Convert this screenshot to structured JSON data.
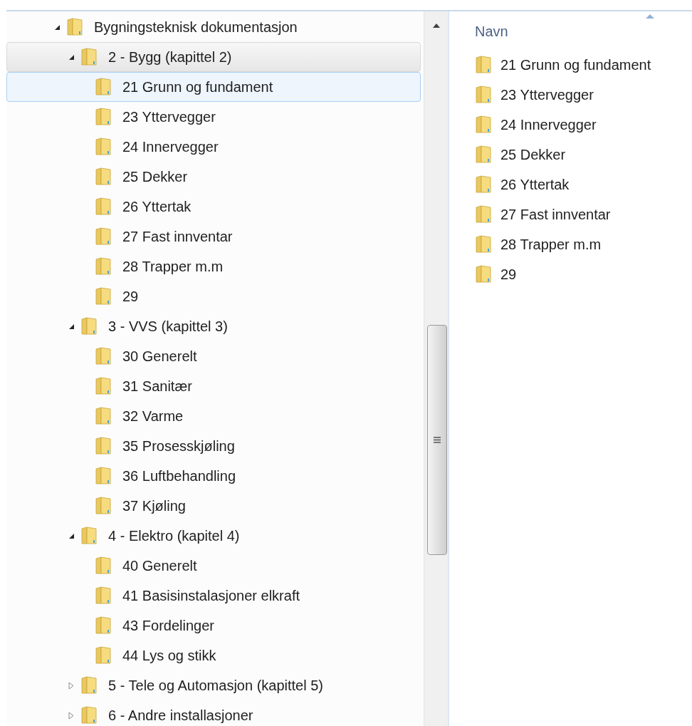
{
  "tree": [
    {
      "label": "Bygningsteknisk dokumentasjon",
      "expanded": true,
      "selected": false,
      "hovered": false,
      "children": [
        {
          "label": "2 - Bygg (kapittel 2)",
          "expanded": true,
          "selected": false,
          "hovered": true,
          "children": [
            {
              "label": "21 Grunn og fundament",
              "selected": true,
              "hovered": false
            },
            {
              "label": "23 Yttervegger",
              "selected": false,
              "hovered": false
            },
            {
              "label": "24 Innervegger",
              "selected": false,
              "hovered": false
            },
            {
              "label": "25 Dekker",
              "selected": false,
              "hovered": false
            },
            {
              "label": "26 Yttertak",
              "selected": false,
              "hovered": false
            },
            {
              "label": "27 Fast innventar",
              "selected": false,
              "hovered": false
            },
            {
              "label": "28 Trapper m.m",
              "selected": false,
              "hovered": false
            },
            {
              "label": "29",
              "selected": false,
              "hovered": false
            }
          ]
        },
        {
          "label": "3 - VVS (kapittel 3)",
          "expanded": true,
          "selected": false,
          "hovered": false,
          "children": [
            {
              "label": "30 Generelt",
              "selected": false,
              "hovered": false
            },
            {
              "label": "31 Sanitær",
              "selected": false,
              "hovered": false
            },
            {
              "label": "32 Varme",
              "selected": false,
              "hovered": false
            },
            {
              "label": "35 Prosesskjøling",
              "selected": false,
              "hovered": false
            },
            {
              "label": "36 Luftbehandling",
              "selected": false,
              "hovered": false
            },
            {
              "label": "37 Kjøling",
              "selected": false,
              "hovered": false
            }
          ]
        },
        {
          "label": "4 - Elektro (kapitel 4)",
          "expanded": true,
          "selected": false,
          "hovered": false,
          "children": [
            {
              "label": "40 Generelt",
              "selected": false,
              "hovered": false
            },
            {
              "label": "41 Basisinstalasjoner elkraft",
              "selected": false,
              "hovered": false
            },
            {
              "label": "43 Fordelinger",
              "selected": false,
              "hovered": false
            },
            {
              "label": "44 Lys og stikk",
              "selected": false,
              "hovered": false
            }
          ]
        },
        {
          "label": "5 - Tele og Automasjon (kapittel 5)",
          "expanded": false,
          "selected": false,
          "hovered": false
        },
        {
          "label": "6 - Andre installasjoner",
          "expanded": false,
          "selected": false,
          "hovered": false
        }
      ]
    }
  ],
  "content": {
    "column_header": "Navn",
    "items": [
      "21 Grunn og fundament",
      "23 Yttervegger",
      "24 Innervegger",
      "25 Dekker",
      "26 Yttertak",
      "27 Fast innventar",
      "28 Trapper m.m",
      "29"
    ]
  }
}
